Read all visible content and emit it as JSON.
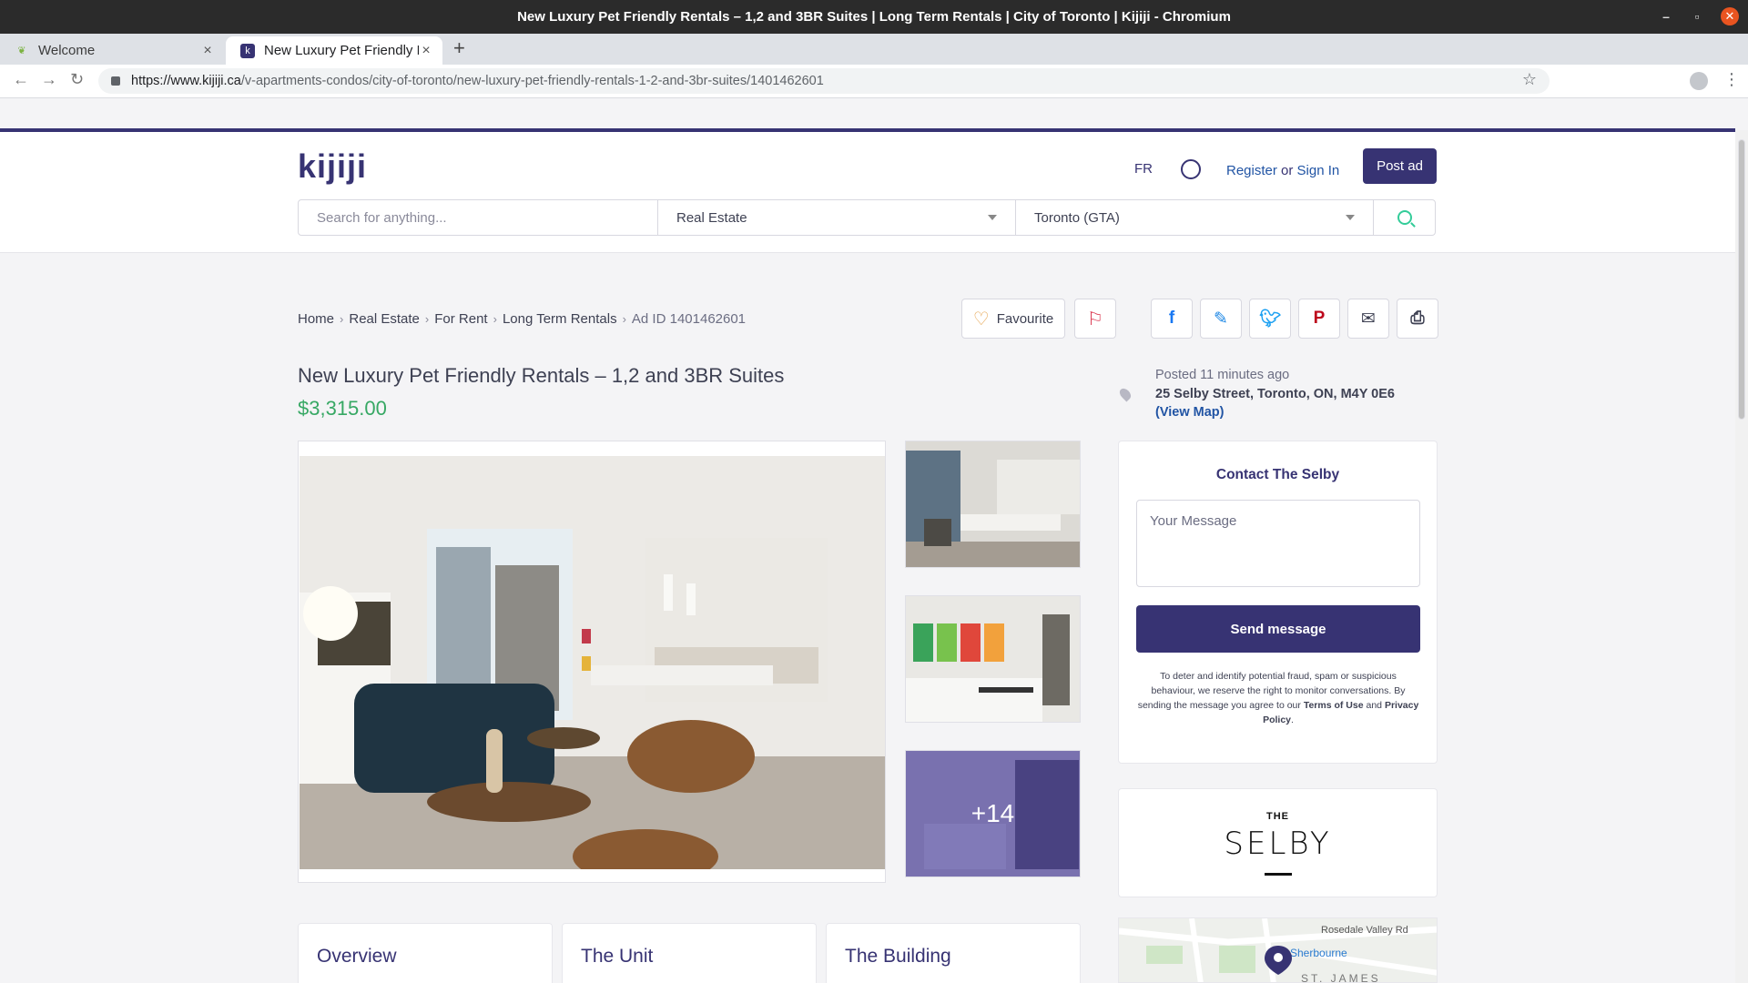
{
  "window": {
    "title": "New Luxury Pet Friendly Rentals – 1,2 and 3BR Suites | Long Term Rentals | City of Toronto | Kijiji - Chromium"
  },
  "tabs": [
    {
      "label": "Welcome",
      "icon": "leaf-icon"
    },
    {
      "label": "New Luxury Pet Friendly Re",
      "icon": "kijiji-favicon"
    }
  ],
  "address_bar": {
    "url_host": "https://www.kijiji.ca",
    "url_path": "/v-apartments-condos/city-of-toronto/new-luxury-pet-friendly-rentals-1-2-and-3br-suites/1401462601"
  },
  "header": {
    "logo": "kijiji",
    "lang": "FR",
    "register": "Register",
    "or": "or",
    "sign_in": "Sign In",
    "post_ad": "Post ad",
    "search_placeholder": "Search for anything...",
    "category": "Real Estate",
    "location": "Toronto (GTA)"
  },
  "breadcrumb": [
    "Home",
    "Real Estate",
    "For Rent",
    "Long Term Rentals"
  ],
  "ad_id": "Ad ID 1401462601",
  "actions": {
    "favourite": "Favourite"
  },
  "listing": {
    "title": "New Luxury Pet Friendly Rentals – 1,2 and 3BR Suites",
    "price": "$3,315.00",
    "posted": "Posted 11 minutes ago",
    "address": "25 Selby Street, Toronto, ON, M4Y 0E6",
    "view_map": "(View Map)",
    "more_photos": "+14"
  },
  "contact": {
    "title": "Contact The Selby",
    "message_placeholder": "Your Message",
    "send": "Send message",
    "disclaimer_pre": "To deter and identify potential fraud, spam or suspicious behaviour, we reserve the right to monitor conversations. By sending the message you agree to our",
    "terms": "Terms of Use",
    "and": "and",
    "privacy": "Privacy Policy",
    "disclaimer_post": "."
  },
  "brand": {
    "the": "THE",
    "name": "SELBY"
  },
  "map": {
    "street1": "Rosedale Valley Rd",
    "station": "Sherbourne",
    "area": "ST. JAMES"
  },
  "sections": [
    "Overview",
    "The Unit",
    "The Building"
  ],
  "colors": {
    "brand": "#373373",
    "price": "#37a864",
    "link": "#2154a4",
    "flag": "#d9324b"
  }
}
